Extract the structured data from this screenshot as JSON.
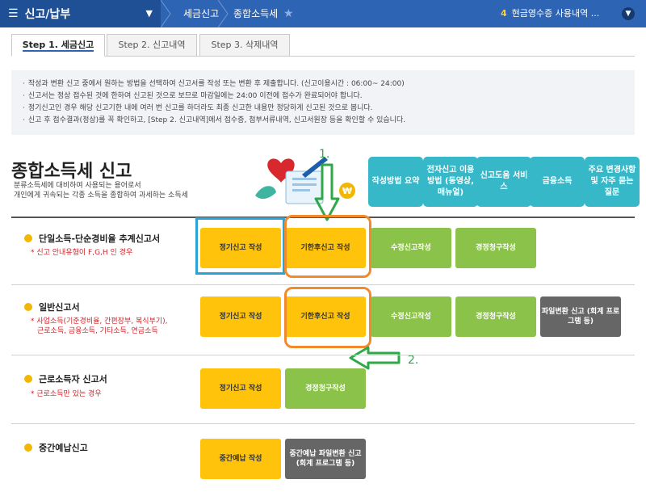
{
  "nav": {
    "menu_icon": "☰",
    "menu_label": "신고/납부",
    "crumb1": "세금신고",
    "crumb2": "종합소득세",
    "notice_num": "4",
    "notice_text": "현금영수증 사용내역 ..."
  },
  "tabs": [
    {
      "label": "Step 1. 세금신고"
    },
    {
      "label": "Step 2. 신고내역"
    },
    {
      "label": "Step 3. 삭제내역"
    }
  ],
  "info_lines": [
    "작성과 변환 신고 중에서 원하는 방법을 선택하여 신고서를 작성 또는 변환 후 제출합니다. (신고이용시간 : 06:00~ 24:00)",
    "신고서는 정상 접수된 것에 한하여 신고된 것으로 보므로 마감일에는 24:00 이전에 접수가 완료되어야 합니다.",
    "정기신고인 경우 해당 신고기한 내에 여러 번 신고를 하더라도 최종 신고한 내용만 정당하게 신고된 것으로 봅니다.",
    "신고 후 접수결과(정상)를 꼭 확인하고, [Step 2. 신고내역]에서 접수증, 첨부서류내역, 신고서원장 등을 확인할 수 있습니다."
  ],
  "header": {
    "title": "종합소득세 신고",
    "subtitle_line1": "분류소득세에 대비하여 사용되는 용어로서",
    "subtitle_line2": "개인에게 귀속되는 각종 소득을 종합하여 과세하는 소득세"
  },
  "info_buttons": [
    {
      "label": "작성방법 요약"
    },
    {
      "label": "전자신고 이용방법 (동영상, 매뉴얼)"
    },
    {
      "label": "신고도움 서비스"
    },
    {
      "label": "금융소득"
    },
    {
      "label": "주요 변경사항 및 자주 묻는 질문"
    }
  ],
  "annotations": {
    "one": "1.",
    "two": "2."
  },
  "sections": [
    {
      "title": "단일소득-단순경비율 추계신고서",
      "note": "* 신고 안내유형이 F,G,H 인 경우",
      "buttons": [
        "정기신고 작성",
        "기한후신고 작성",
        "수정신고작성",
        "경정청구작성"
      ]
    },
    {
      "title": "일반신고서",
      "note_line1": "* 사업소득(기준경비율, 간편장부, 복식부기),",
      "note_line2": "근로소득, 금융소득, 기타소득, 연금소득",
      "buttons": [
        "정기신고 작성",
        "기한후신고 작성",
        "수정신고작성",
        "경정청구작성",
        "파일변환 신고 (회계 프로그램 등)"
      ]
    },
    {
      "title": "근로소득자 신고서",
      "note": "* 근로소득만 있는 경우",
      "buttons": [
        "정기신고 작성",
        "경정청구작성"
      ]
    },
    {
      "title": "중간예납신고",
      "buttons": [
        "중간예납 작성",
        "중간예납 파일변환 신고 (회계 프로그램 등)"
      ]
    }
  ],
  "colors": {
    "nav_blue": "#2d65b4",
    "yellow_btn": "#fec30a",
    "green_btn": "#8bc34a",
    "gray_btn": "#666666",
    "teal_btn": "#36b8c8",
    "highlight_orange": "#f08a2c",
    "highlight_blue": "#2ba3d6",
    "annotation_green": "#2fa84a"
  }
}
